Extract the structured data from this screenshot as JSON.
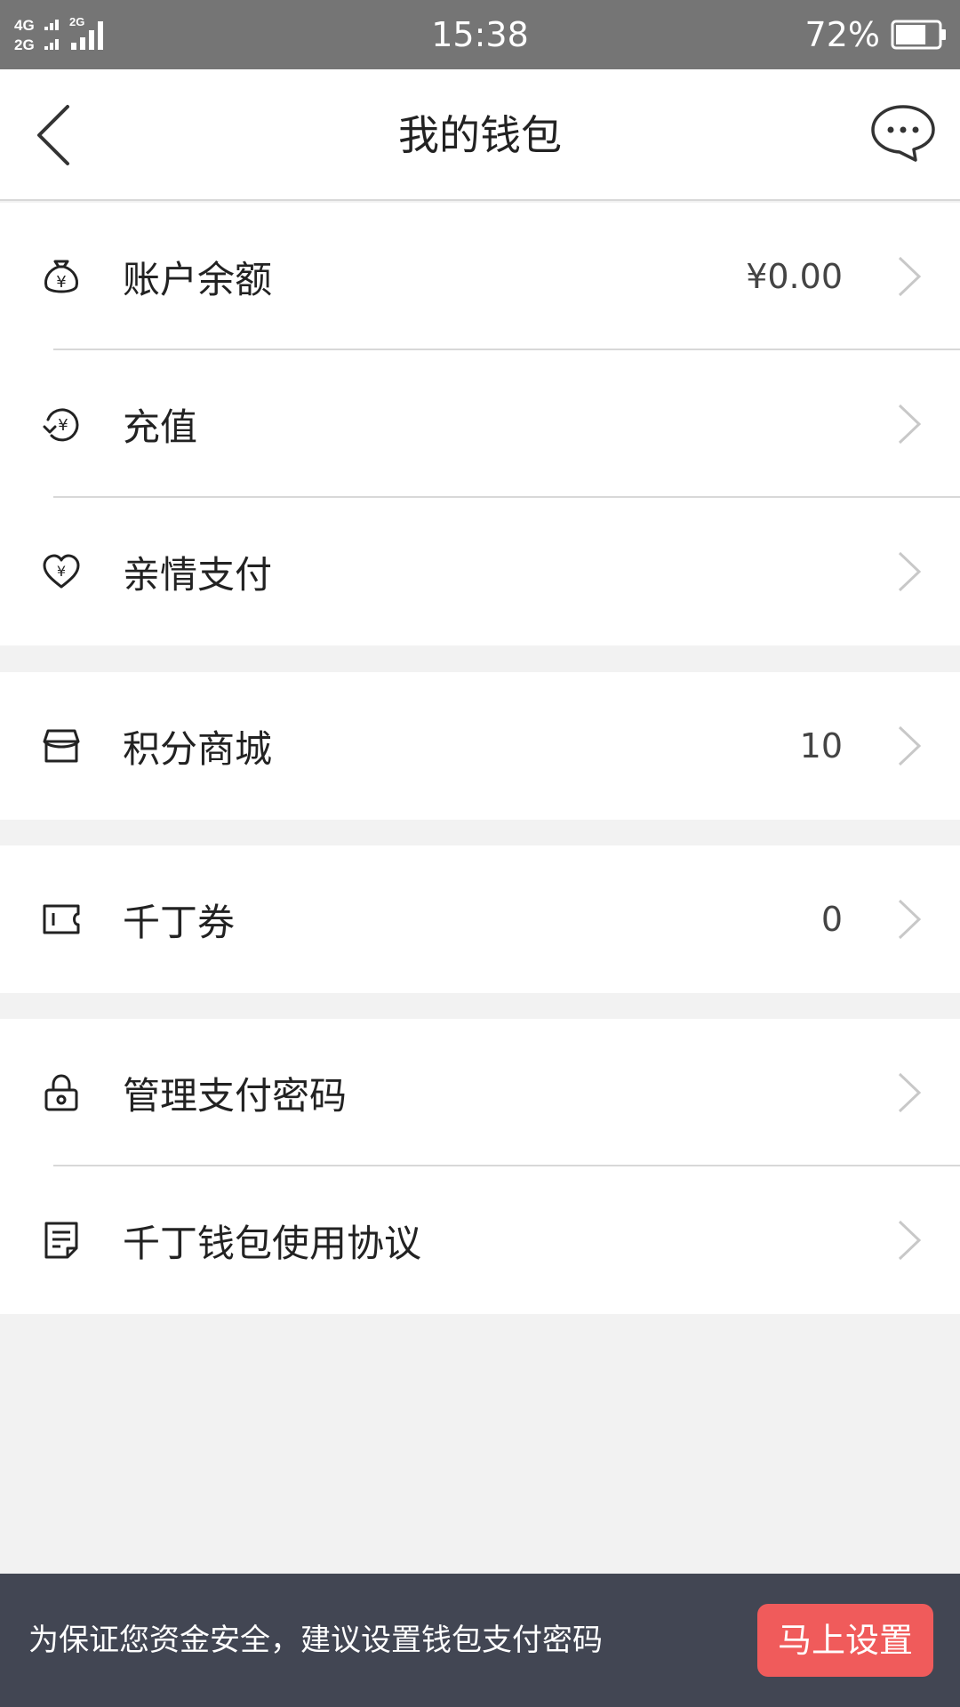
{
  "status_bar": {
    "network_top": "4G",
    "network_bottom": "2G",
    "network_secondary": "2G",
    "time": "15:38",
    "battery_percent": "72%",
    "battery_level": 0.72
  },
  "header": {
    "title": "我的钱包",
    "back_icon": "back-chevron-icon",
    "message_icon": "chat-bubble-icon"
  },
  "groups": [
    {
      "items": [
        {
          "label": "账户余额",
          "value": "¥0.00",
          "icon": "money-bag-icon"
        },
        {
          "label": "充值",
          "value": "",
          "icon": "recharge-icon"
        },
        {
          "label": "亲情支付",
          "value": "",
          "icon": "heart-yuan-icon"
        }
      ]
    },
    {
      "items": [
        {
          "label": "积分商城",
          "value": "10",
          "icon": "store-icon"
        }
      ]
    },
    {
      "items": [
        {
          "label": "千丁券",
          "value": "0",
          "icon": "ticket-icon"
        }
      ]
    },
    {
      "items": [
        {
          "label": "管理支付密码",
          "value": "",
          "icon": "lock-icon"
        },
        {
          "label": "千丁钱包使用协议",
          "value": "",
          "icon": "document-icon"
        }
      ]
    }
  ],
  "banner": {
    "text": "为保证您资金安全，建议设置钱包支付密码",
    "button_label": "马上设置"
  },
  "colors": {
    "status_bar": "#757575",
    "banner": "#424653",
    "accent_button": "#f05b5b",
    "background": "#f2f2f2"
  }
}
